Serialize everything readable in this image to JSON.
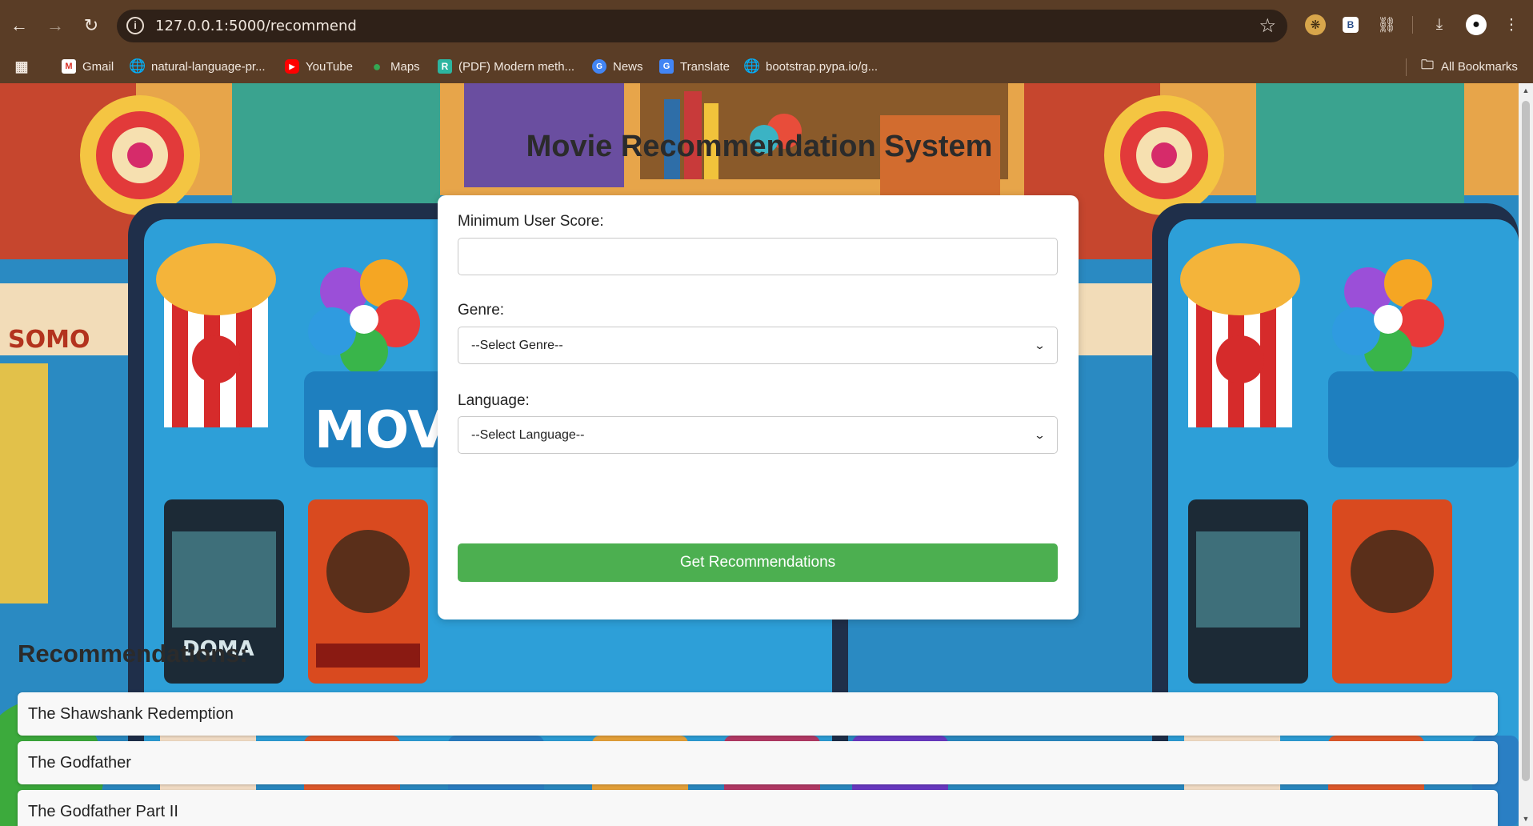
{
  "browser": {
    "url": "127.0.0.1:5000/recommend",
    "nav_icons": [
      "back-arrow-icon",
      "forward-arrow-icon",
      "reload-icon"
    ],
    "bookmarks": [
      {
        "label": "Gmail",
        "icon": "gmail-icon"
      },
      {
        "label": "natural-language-pr...",
        "icon": "globe-icon"
      },
      {
        "label": "YouTube",
        "icon": "youtube-icon"
      },
      {
        "label": "Maps",
        "icon": "maps-icon"
      },
      {
        "label": "(PDF) Modern meth...",
        "icon": "researchgate-icon"
      },
      {
        "label": "News",
        "icon": "news-icon"
      },
      {
        "label": "Translate",
        "icon": "translate-icon"
      },
      {
        "label": "bootstrap.pypa.io/g...",
        "icon": "globe-icon"
      }
    ],
    "all_bookmarks": "All Bookmarks",
    "extension_b_label": "B"
  },
  "page": {
    "title": "Movie Recommendation System",
    "form": {
      "score_label": "Minimum User Score:",
      "score_value": "",
      "genre_label": "Genre:",
      "genre_selected": "--Select Genre--",
      "language_label": "Language:",
      "language_selected": "--Select Language--",
      "submit_label": "Get Recommendations",
      "submit_color": "#4caf50"
    },
    "recommendations_heading": "Recommendations:",
    "recommendations": [
      "The Shawshank Redemption",
      "The Godfather",
      "The Godfather Part II"
    ]
  }
}
